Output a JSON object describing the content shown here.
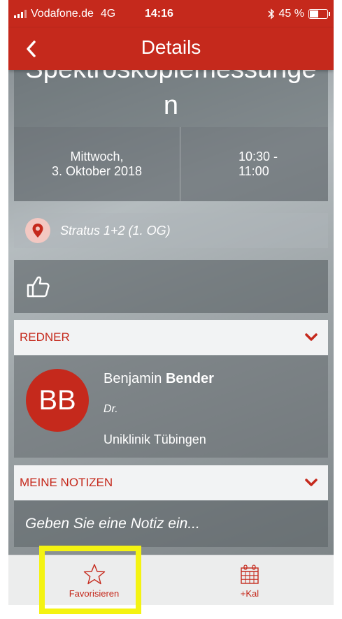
{
  "status_bar": {
    "carrier": "Vodafone.de",
    "network": "4G",
    "time": "14:16",
    "battery": "45 %"
  },
  "nav": {
    "title": "Details",
    "back_icon": "chevron-left-icon"
  },
  "event": {
    "title_line1": "Spektroskopiemessunge",
    "title_line2": "n",
    "date_line1": "Mittwoch,",
    "date_line2": "3. Oktober 2018",
    "time_line1": "10:30 -",
    "time_line2": "11:00",
    "location": "Stratus 1+2 (1. OG)"
  },
  "sections": {
    "speakers_label": "REDNER",
    "notes_label": "MEINE NOTIZEN"
  },
  "speaker": {
    "initials": "BB",
    "first_name": "Benjamin",
    "last_name": "Bender",
    "title": "Dr.",
    "organization": "Uniklinik Tübingen"
  },
  "notes": {
    "placeholder": "Geben Sie eine Notiz ein..."
  },
  "tabs": {
    "favorite_label": "Favorisieren",
    "calendar_label": "+Kal"
  },
  "colors": {
    "accent": "#c5291c",
    "highlight": "#f4f312"
  }
}
